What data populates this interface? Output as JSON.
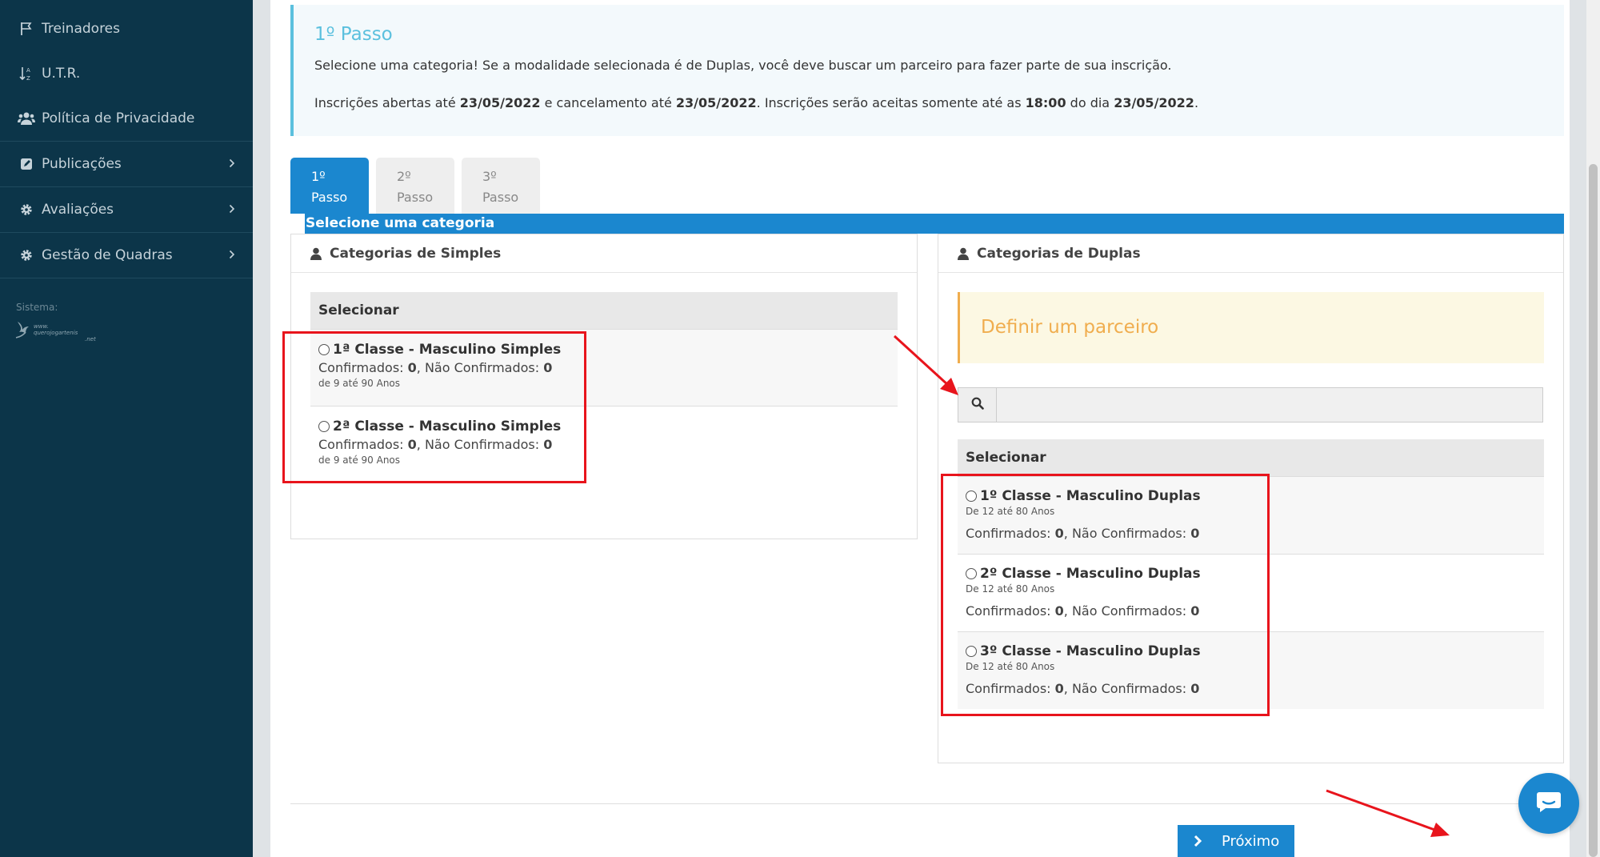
{
  "sidebar": {
    "items": [
      {
        "label": "Treinadores",
        "icon": "flag-icon"
      },
      {
        "label": "U.T.R.",
        "icon": "sort-alpha-icon"
      },
      {
        "label": "Política de Privacidade",
        "icon": "users-icon"
      },
      {
        "label": "Publicações",
        "icon": "edit-square-icon"
      },
      {
        "label": "Avaliações",
        "icon": "gear-icon"
      },
      {
        "label": "Gestão de Quadras",
        "icon": "gear-icon"
      }
    ],
    "system_label": "Sistema:",
    "logo_text": "www.querojogartenis.net"
  },
  "info": {
    "title": "1º Passo",
    "line1": "Selecione uma categoria! Se a modalidade selecionada é de Duplas, você deve buscar um parceiro para fazer parte de sua inscrição.",
    "line2": {
      "p1": "Inscrições abertas até ",
      "d1": "23/05/2022",
      "p2": " e cancelamento até ",
      "d2": "23/05/2022",
      "p3": ". Inscrições serão aceitas somente até as ",
      "t": "18:00",
      "p4": " do dia ",
      "d3": "23/05/2022",
      "p5": "."
    }
  },
  "tabs": [
    {
      "num": "1º",
      "label": "Passo"
    },
    {
      "num": "2º",
      "label": "Passo"
    },
    {
      "num": "3º",
      "label": "Passo"
    }
  ],
  "panel_title": "Selecione uma categoria",
  "simples": {
    "title": "Categorias de Simples",
    "select_header": "Selecionar",
    "rows": [
      {
        "title": "1ª Classe - Masculino Simples",
        "confirmed_label": "Confirmados: ",
        "confirmed": "0",
        "unconfirmed_label": ", Não Confirmados: ",
        "unconfirmed": "0",
        "age": "de 9 até 90 Anos"
      },
      {
        "title": "2ª Classe - Masculino Simples",
        "confirmed_label": "Confirmados: ",
        "confirmed": "0",
        "unconfirmed_label": ", Não Confirmados: ",
        "unconfirmed": "0",
        "age": "de 9 até 90 Anos"
      }
    ]
  },
  "duplas": {
    "title": "Categorias de Duplas",
    "partner_warning": "Definir um parceiro",
    "search_value": "",
    "select_header": "Selecionar",
    "rows": [
      {
        "title": "1º Classe - Masculino Duplas",
        "age": "De 12 até 80 Anos",
        "confirmed_label": "Confirmados: ",
        "confirmed": "0",
        "unconfirmed_label": ", Não Confirmados: ",
        "unconfirmed": "0"
      },
      {
        "title": "2º Classe - Masculino Duplas",
        "age": "De 12 até 80 Anos",
        "confirmed_label": "Confirmados: ",
        "confirmed": "0",
        "unconfirmed_label": ", Não Confirmados: ",
        "unconfirmed": "0"
      },
      {
        "title": "3º Classe - Masculino Duplas",
        "age": "De 12 até 80 Anos",
        "confirmed_label": "Confirmados: ",
        "confirmed": "0",
        "unconfirmed_label": ", Não Confirmados: ",
        "unconfirmed": "0"
      }
    ]
  },
  "next_button": "Próximo",
  "colors": {
    "sidebar_bg": "#0c3549",
    "primary": "#1b87cf",
    "info_accent": "#5bc0de",
    "warning": "#f0ad4e",
    "annotation_red": "#e8141c"
  }
}
